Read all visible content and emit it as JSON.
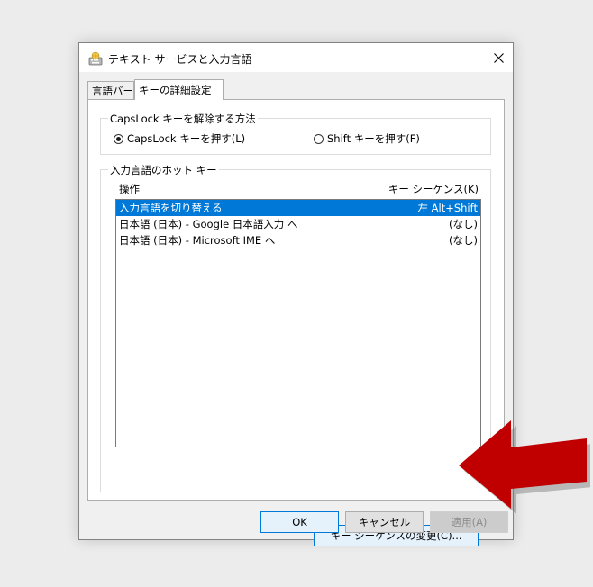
{
  "window": {
    "title": "テキスト サービスと入力言語",
    "icon": "keyboard-globe-icon"
  },
  "tabs": [
    {
      "label": "言語バー",
      "active": false
    },
    {
      "label": "キーの詳細設定",
      "active": true
    }
  ],
  "capslock_group": {
    "title": "CapsLock キーを解除する方法",
    "options": [
      {
        "label": "CapsLock キーを押す(L)",
        "selected": true
      },
      {
        "label": "Shift キーを押す(F)",
        "selected": false
      }
    ]
  },
  "hotkey_group": {
    "title": "入力言語のホット キー",
    "columns": [
      "操作",
      "キー シーケンス(K)"
    ],
    "rows": [
      {
        "action": "入力言語を切り替える",
        "sequence": "左 Alt+Shift",
        "selected": true
      },
      {
        "action": "日本語 (日本) - Google 日本語入力 へ",
        "sequence": "(なし)",
        "selected": false
      },
      {
        "action": "日本語 (日本) - Microsoft IME へ",
        "sequence": "(なし)",
        "selected": false
      }
    ],
    "change_button": "キー シーケンスの変更(C)..."
  },
  "footer": {
    "ok": "OK",
    "cancel": "キャンセル",
    "apply": "適用(A)"
  },
  "colors": {
    "selection": "#0078d7",
    "arrow": "#c00000"
  }
}
